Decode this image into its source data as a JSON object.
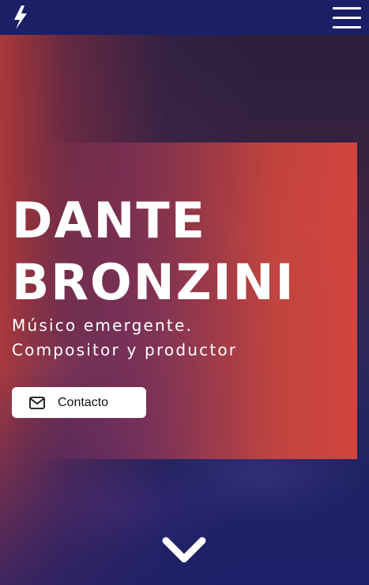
{
  "header": {
    "logo_icon": "lightning-bolt-icon",
    "menu_icon": "hamburger-menu-icon",
    "background": "#1b1f66"
  },
  "hero": {
    "title_lines": [
      "DANTE",
      "BRONZINI"
    ],
    "subtitle_lines": [
      "Músico emergente.",
      "Compositor y productor"
    ],
    "contact_button": {
      "label": "Contacto",
      "icon": "envelope-icon"
    },
    "scroll_icon": "chevron-down-icon",
    "accent": "#d2453e"
  }
}
